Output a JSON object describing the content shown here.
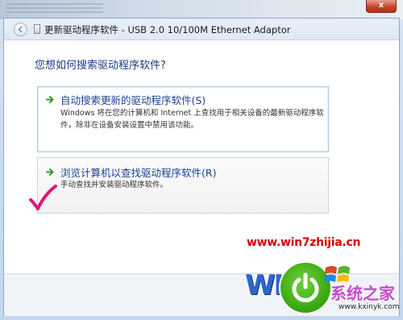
{
  "window": {
    "title": "更新驱动程序软件 - USB 2.0 10/100M Ethernet Adaptor",
    "close_glyph": "x"
  },
  "content": {
    "heading": "您想如何搜索驱动程序软件?",
    "options": [
      {
        "title": "自动搜索更新的驱动程序软件(S)",
        "description": "Windows 将在您的计算机和 Internet 上查找用于相关设备的最新驱动程序软件，除非在设备安装设置中禁用该功能。"
      },
      {
        "title": "浏览计算机以查找驱动程序软件(R)",
        "description": "手动查找并安装驱动程序软件。"
      }
    ]
  },
  "watermark": {
    "url": "www.win7zhijia.cn",
    "logo_text": "WIN7",
    "brand_name": "系统之家",
    "brand_url": "www.kxinyk.com"
  },
  "colors": {
    "heading": "#1d3b86",
    "option_title": "#1f4193",
    "arrow": "#2fa028",
    "checkmark": "#e0157a",
    "watermark_red": "#d40000"
  }
}
